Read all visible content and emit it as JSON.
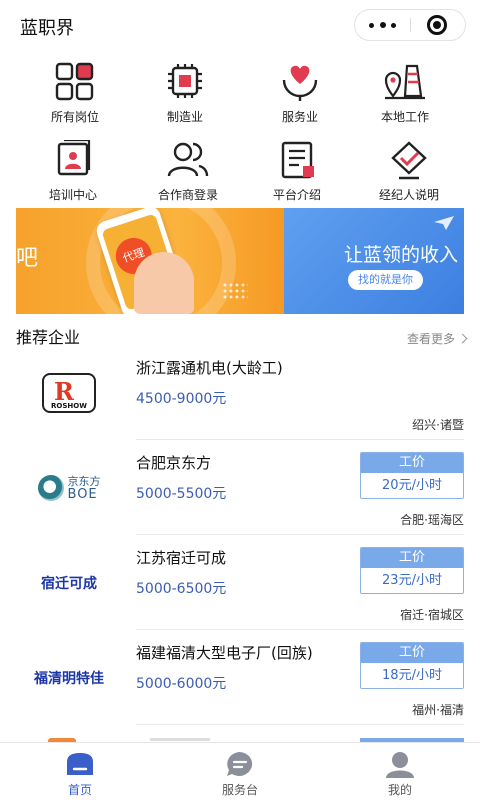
{
  "header": {
    "title": "蓝职界",
    "more_icon": "more-dots-icon",
    "close_icon": "target-close-icon"
  },
  "categories": [
    {
      "label": "所有岗位",
      "icon": "grid-icon"
    },
    {
      "label": "制造业",
      "icon": "chip-icon"
    },
    {
      "label": "服务业",
      "icon": "heart-hand-icon"
    },
    {
      "label": "本地工作",
      "icon": "location-building-icon"
    },
    {
      "label": "培训中心",
      "icon": "certificate-icon"
    },
    {
      "label": "合作商登录",
      "icon": "users-icon"
    },
    {
      "label": "平台介绍",
      "icon": "document-icon"
    },
    {
      "label": "经纪人说明",
      "icon": "badge-check-icon"
    }
  ],
  "banner": {
    "left_text": "吧",
    "stamp_text": "代理",
    "right_title": "让蓝领的收入",
    "right_pill": "找的就是你"
  },
  "section": {
    "title": "推荐企业",
    "more": "查看更多"
  },
  "companies": [
    {
      "name": "浙江露通机电(大龄工)",
      "salary": "4500-9000元",
      "location": "绍兴·诸暨",
      "logo_text": "ROSHOW",
      "logo_letter": "R"
    },
    {
      "name": "合肥京东方",
      "salary": "5000-5500元",
      "location": "合肥·瑶海区",
      "wage_label": "工价",
      "wage_value": "20元/小时",
      "logo_cn": "京东方",
      "logo_en": "BOE"
    },
    {
      "name": "江苏宿迁可成",
      "salary": "5000-6500元",
      "location": "宿迁·宿城区",
      "wage_label": "工价",
      "wage_value": "23元/小时",
      "logo_text": "宿迁可成"
    },
    {
      "name": "福建福清大型电子厂(回族)",
      "salary": "5000-6000元",
      "location": "福州·福清",
      "wage_label": "工价",
      "wage_value": "18元/小时",
      "logo_text": "福清明特佳"
    }
  ],
  "tabbar": [
    {
      "label": "首页",
      "icon": "home-icon",
      "active": true
    },
    {
      "label": "服务台",
      "icon": "chat-icon",
      "active": false
    },
    {
      "label": "我的",
      "icon": "user-icon",
      "active": false
    }
  ],
  "colors": {
    "accent": "#3a5fc8",
    "salary": "#3b5db3",
    "wage_header": "#7aa9ea",
    "banner_orange": "#f6a22c",
    "banner_blue": "#4a86e8"
  }
}
